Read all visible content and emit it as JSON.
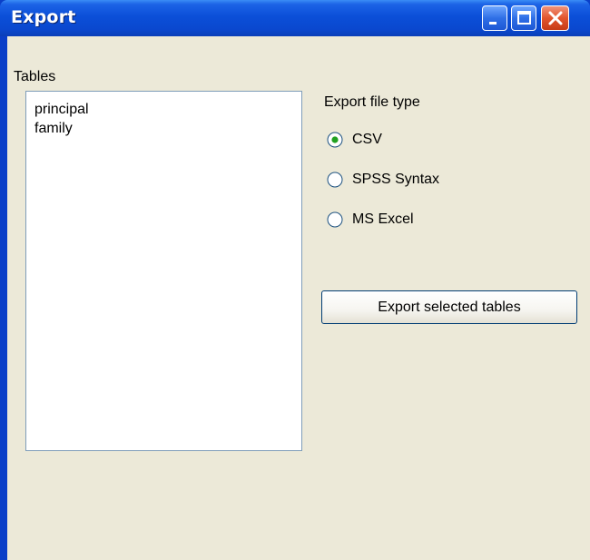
{
  "window": {
    "title": "Export",
    "controls": {
      "minimize": "minimize-icon",
      "maximize": "maximize-icon",
      "close": "close-icon"
    }
  },
  "tables": {
    "label": "Tables",
    "items": [
      "principal",
      "family"
    ]
  },
  "export_type": {
    "label": "Export file type",
    "options": [
      {
        "label": "CSV",
        "selected": true
      },
      {
        "label": "SPSS Syntax",
        "selected": false
      },
      {
        "label": "MS Excel",
        "selected": false
      }
    ]
  },
  "export_button": {
    "label": "Export selected tables"
  },
  "colors": {
    "titlebar": "#0b4fd8",
    "client_bg": "#ece9d8",
    "list_border": "#7f9db9",
    "radio_dot": "#21a121",
    "close_button": "#e2552d"
  }
}
